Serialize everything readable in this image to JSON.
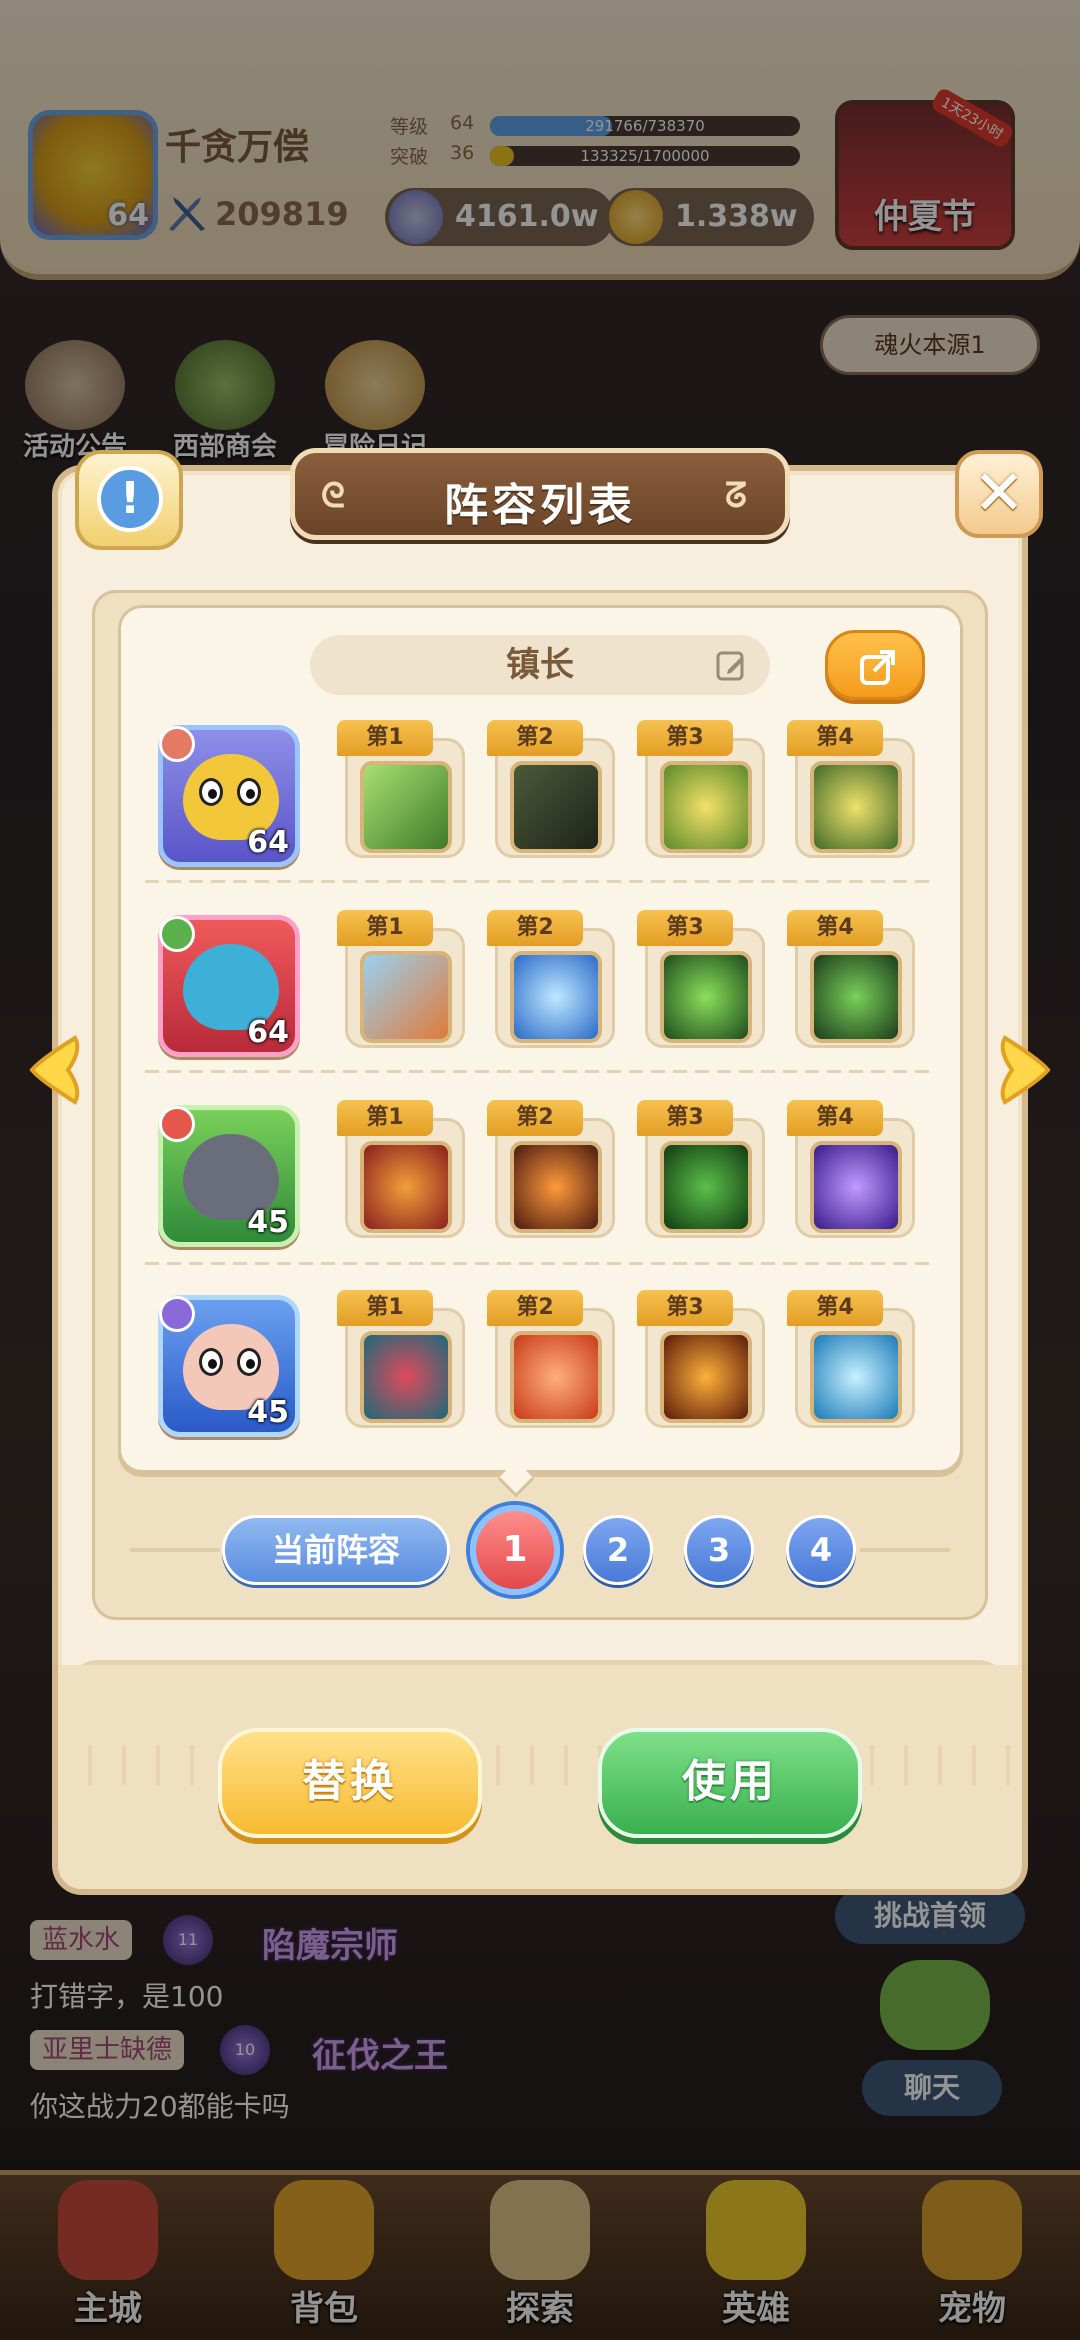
{
  "player": {
    "name": "千贪万偿",
    "level_badge": "64",
    "power": "209819",
    "level_label": "等级",
    "level_value": "64",
    "level_progress_text": "291766/738370",
    "level_progress": 0.395,
    "break_label": "突破",
    "break_value": "36",
    "break_progress_text": "133325/1700000",
    "break_progress": 0.078
  },
  "currencies": [
    {
      "icon": "coin-silver-icon",
      "value": "4161.0w"
    },
    {
      "icon": "coin-gold-icon",
      "value": "1.338w"
    }
  ],
  "event": {
    "label": "仲夏节",
    "timer": "1天23小时"
  },
  "shortcuts": [
    "活动公告",
    "西部商会",
    "冒险日记"
  ],
  "soul_button": "魂火本源1",
  "chat": [
    {
      "name": "蓝水水",
      "badge": "11",
      "title": "陷魔宗师",
      "message": "打错字，是100"
    },
    {
      "name": "亚里士缺德",
      "badge": "10",
      "title": "征伐之王",
      "message": "你这战力20都能卡吗"
    }
  ],
  "side_buttons": {
    "challenge": "挑战首领",
    "chat": "聊天"
  },
  "nav": [
    "主城",
    "背包",
    "探索",
    "英雄",
    "宠物"
  ],
  "modal": {
    "title": "阵容列表",
    "lineup_name": "镇长",
    "current_lineup_label": "当前阵容",
    "pages": [
      "1",
      "2",
      "3",
      "4"
    ],
    "active_page": "1",
    "replace_label": "替换",
    "use_label": "使用",
    "rows": [
      {
        "hero_level": "64",
        "hero": "yellow-hero",
        "skills": [
          {
            "tag": "第1",
            "icon": "hammer-skill-icon"
          },
          {
            "tag": "第2",
            "icon": "dark-claw-skill-icon"
          },
          {
            "tag": "第3",
            "icon": "golden-shield-skill-icon"
          },
          {
            "tag": "第4",
            "icon": "star-shield-skill-icon"
          }
        ]
      },
      {
        "hero_level": "64",
        "hero": "blue-fish-hero",
        "skills": [
          {
            "tag": "第1",
            "icon": "lion-skill-icon"
          },
          {
            "tag": "第2",
            "icon": "spear-skill-icon"
          },
          {
            "tag": "第3",
            "icon": "green-beast-skill-icon"
          },
          {
            "tag": "第4",
            "icon": "green-spear-skill-icon"
          }
        ]
      },
      {
        "hero_level": "45",
        "hero": "hippo-hero",
        "skills": [
          {
            "tag": "第1",
            "icon": "paw-skill-icon"
          },
          {
            "tag": "第2",
            "icon": "fire-burst-skill-icon"
          },
          {
            "tag": "第3",
            "icon": "vine-skill-icon"
          },
          {
            "tag": "第4",
            "icon": "purple-magic-skill-icon"
          }
        ]
      },
      {
        "hero_level": "45",
        "hero": "pig-hero",
        "skills": [
          {
            "tag": "第1",
            "icon": "mask-skill-icon"
          },
          {
            "tag": "第2",
            "icon": "fist-skill-icon"
          },
          {
            "tag": "第3",
            "icon": "flame-skill-icon"
          },
          {
            "tag": "第4",
            "icon": "ice-staff-skill-icon"
          }
        ]
      }
    ]
  }
}
